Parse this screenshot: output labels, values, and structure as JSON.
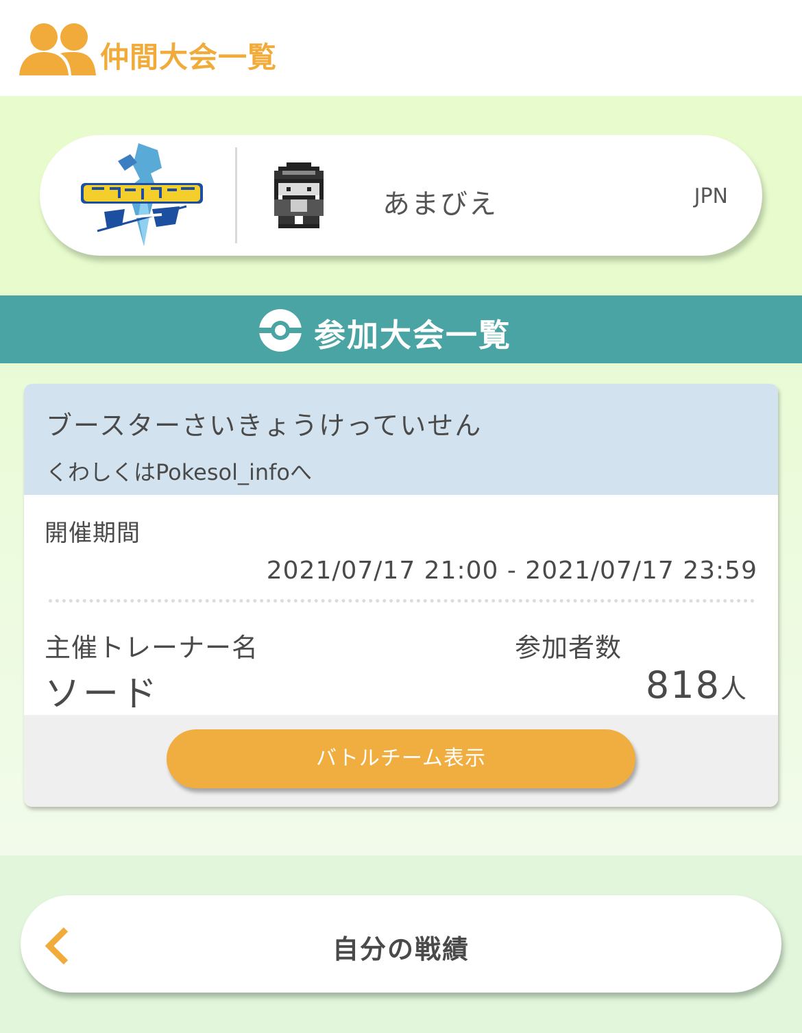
{
  "header": {
    "title": "仲間大会一覧",
    "icon": "people-icon",
    "accent_color": "#f0ab3a"
  },
  "profile": {
    "game_logo_text": "ポケットモンスター ソード",
    "player_name": "あまびえ",
    "region": "JPN"
  },
  "section": {
    "title": "参加大会一覧",
    "icon": "pokeball-icon",
    "bar_color": "#4ba4a4"
  },
  "tournament": {
    "name": "ブースターさいきょうけっていせん",
    "description": "くわしくはPokesol_infoへ",
    "period_label": "開催期間",
    "period_value": "2021/07/17 21:00 - 2021/07/17 23:59",
    "host_label": "主催トレーナー名",
    "host_name": "ソード",
    "participants_label": "参加者数",
    "participants_count": "818",
    "participants_unit": "人",
    "battle_team_button": "バトルチーム表示"
  },
  "footer": {
    "record_button": "自分の戦績",
    "back_icon": "chevron-left-icon"
  }
}
